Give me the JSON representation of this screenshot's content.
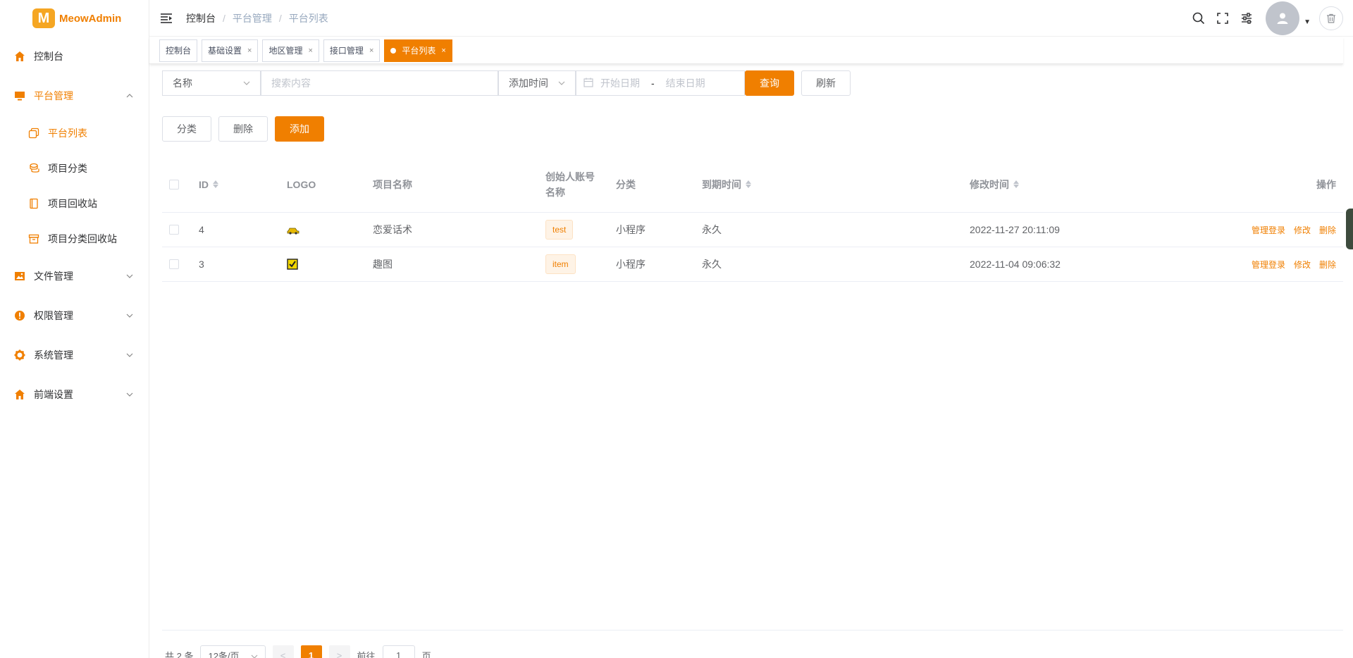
{
  "app": {
    "logo_letter": "M",
    "name": "MeowAdmin",
    "accent": "#f07f00"
  },
  "sidebar": {
    "items": [
      {
        "label": "控制台",
        "icon": "home-icon"
      },
      {
        "label": "平台管理",
        "icon": "monitor-icon",
        "expanded": true,
        "children": [
          {
            "label": "平台列表",
            "icon": "copy-icon",
            "active": true
          },
          {
            "label": "项目分类",
            "icon": "coins-icon"
          },
          {
            "label": "项目回收站",
            "icon": "notebook-icon"
          },
          {
            "label": "项目分类回收站",
            "icon": "archive-icon"
          }
        ]
      },
      {
        "label": "文件管理",
        "icon": "image-icon"
      },
      {
        "label": "权限管理",
        "icon": "warning-circle-icon"
      },
      {
        "label": "系统管理",
        "icon": "gear-icon"
      },
      {
        "label": "前端设置",
        "icon": "home-icon"
      }
    ]
  },
  "header": {
    "breadcrumb": [
      "控制台",
      "平台管理",
      "平台列表"
    ],
    "separator": "/"
  },
  "tags": [
    {
      "label": "控制台",
      "closable": false
    },
    {
      "label": "基础设置",
      "closable": true
    },
    {
      "label": "地区管理",
      "closable": true
    },
    {
      "label": "接口管理",
      "closable": true
    },
    {
      "label": "平台列表",
      "closable": true,
      "active": true
    }
  ],
  "tag_close": "×",
  "search": {
    "field_select": "名称",
    "keyword_placeholder": "搜索内容",
    "time_select": "添加时间",
    "start_placeholder": "开始日期",
    "date_separator": "-",
    "end_placeholder": "结束日期",
    "query_label": "查询",
    "refresh_label": "刷新"
  },
  "actions": {
    "category_label": "分类",
    "delete_label": "删除",
    "add_label": "添加"
  },
  "table": {
    "headers": {
      "id": "ID",
      "logo": "LOGO",
      "name": "项目名称",
      "creator_line1": "创始人账号",
      "creator_line2": "名称",
      "category": "分类",
      "expire": "到期时间",
      "modified": "修改时间",
      "ops": "操作"
    },
    "rows": [
      {
        "id": "4",
        "logo": "car-logo",
        "name": "恋爱话术",
        "creator": "test",
        "category": "小程序",
        "expire": "永久",
        "modified": "2022-11-27 20:11:09"
      },
      {
        "id": "3",
        "logo": "checkbox-logo",
        "name": "趣图",
        "creator": "item",
        "category": "小程序",
        "expire": "永久",
        "modified": "2022-11-04 09:06:32"
      }
    ],
    "row_ops": {
      "login": "管理登录",
      "edit": "修改",
      "delete": "删除"
    }
  },
  "pagination": {
    "total_text": "共 2 条",
    "page_size": "12条/页",
    "prev": "<",
    "current_page": "1",
    "next": ">",
    "goto_prefix": "前往",
    "goto_value": "1",
    "goto_suffix": "页"
  }
}
